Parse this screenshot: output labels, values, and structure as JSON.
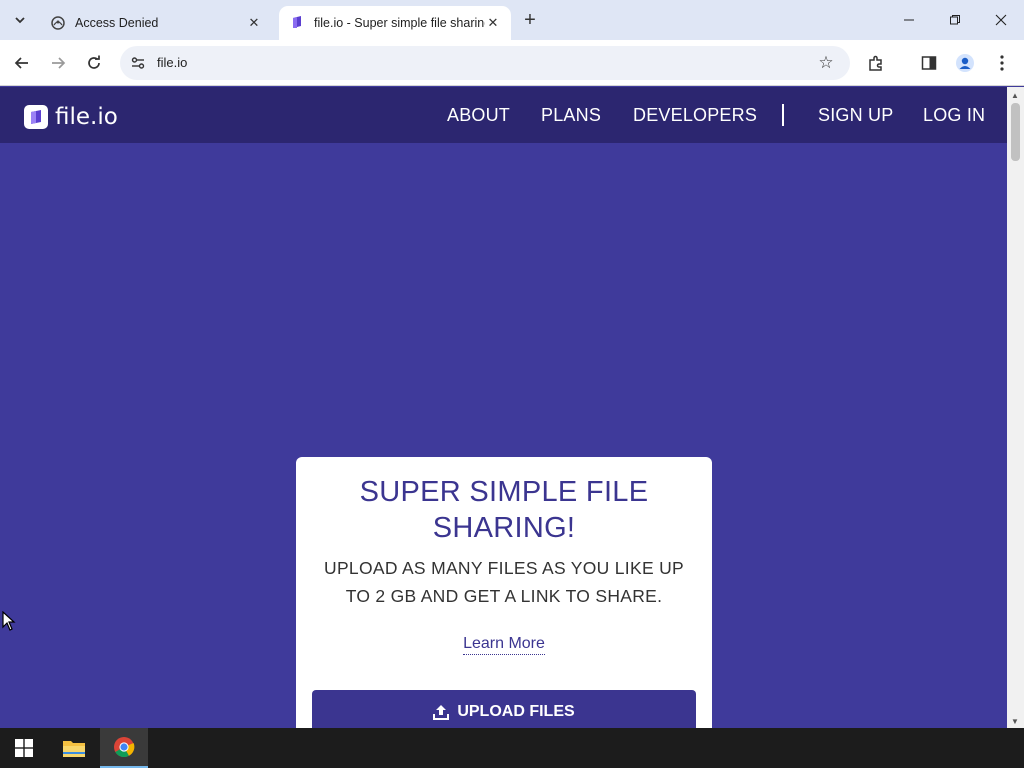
{
  "browser": {
    "tabs": [
      {
        "title": "Access Denied",
        "active": false
      },
      {
        "title": "file.io - Super simple file sharing",
        "active": true
      }
    ],
    "url": "file.io"
  },
  "site": {
    "logo_text": "file.io",
    "nav": {
      "about": "ABOUT",
      "plans": "PLANS",
      "developers": "DEVELOPERS",
      "sign_up": "SIGN UP",
      "log_in": "LOG IN"
    }
  },
  "hero": {
    "title": "SUPER SIMPLE FILE SHARING!",
    "subtitle": "UPLOAD AS MANY FILES AS YOU LIKE UP TO 2 GB AND GET A LINK TO SHARE.",
    "learn_more": "Learn More",
    "upload_button": "UPLOAD FILES"
  },
  "colors": {
    "page_bg": "#3f3a9b",
    "nav_bg": "#2c2670",
    "brand": "#3b3590"
  }
}
